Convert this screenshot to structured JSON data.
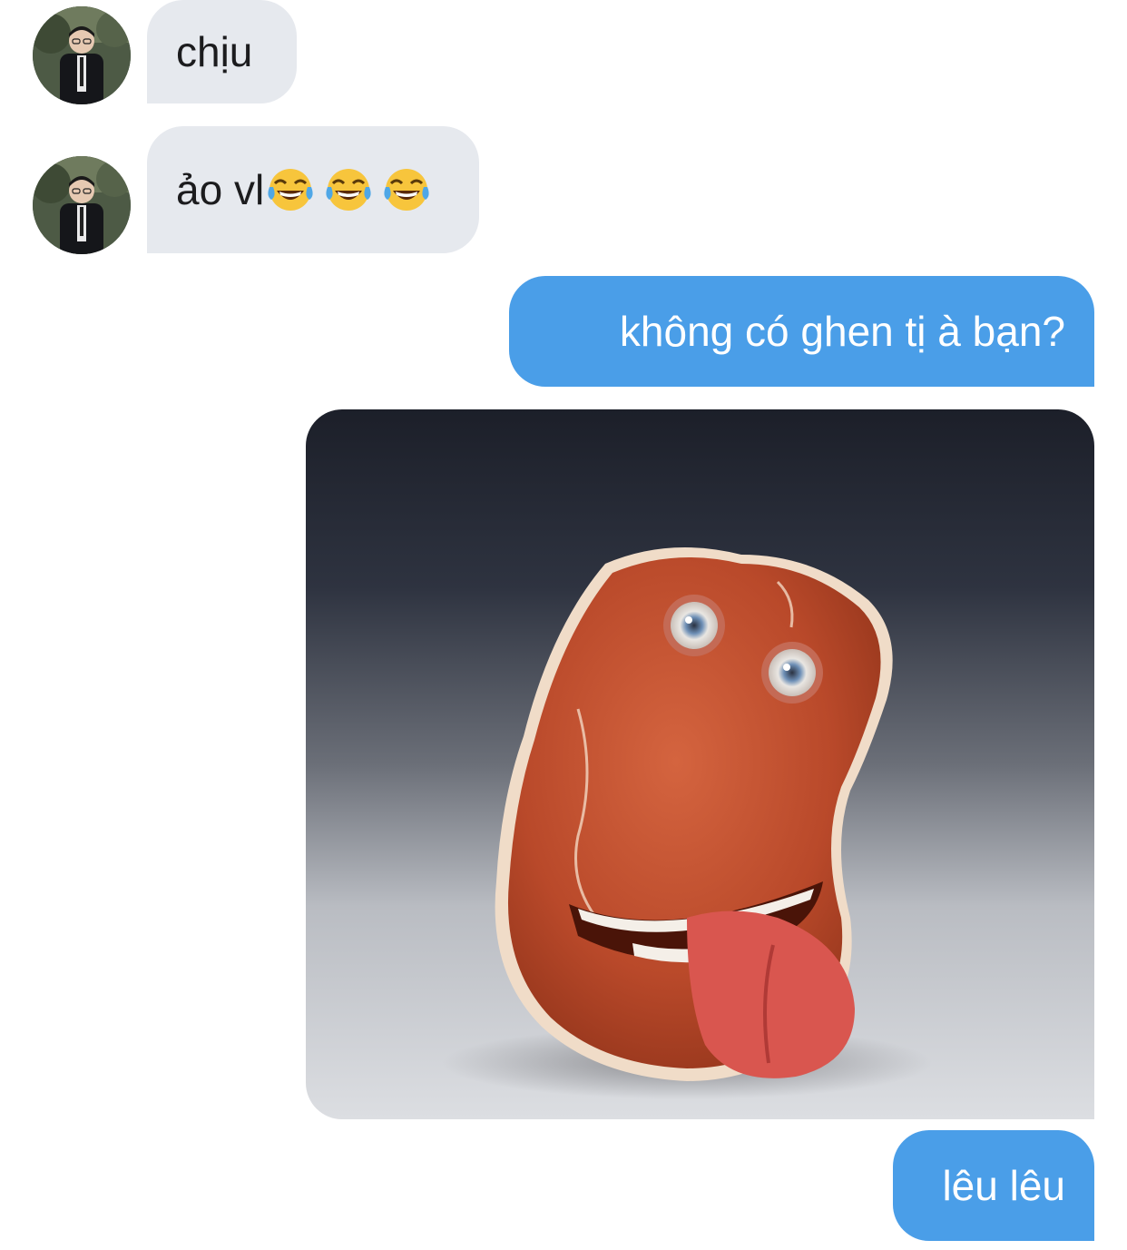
{
  "messages": [
    {
      "side": "incoming",
      "text": "chịu"
    },
    {
      "side": "incoming",
      "text": "ảo vl",
      "emoji": [
        "face-with-tears-of-joy",
        "face-with-tears-of-joy",
        "face-with-tears-of-joy"
      ]
    },
    {
      "side": "outgoing",
      "text": "không có ghen tị à bạn?"
    },
    {
      "side": "outgoing",
      "image": "bean-character-with-tongue-out"
    },
    {
      "side": "outgoing",
      "text": "lêu lêu"
    }
  ],
  "colors": {
    "incoming_bubble": "#e6e9ee",
    "outgoing_bubble": "#4a9ee8",
    "incoming_text": "#1c1c1e",
    "outgoing_text": "#ffffff"
  }
}
